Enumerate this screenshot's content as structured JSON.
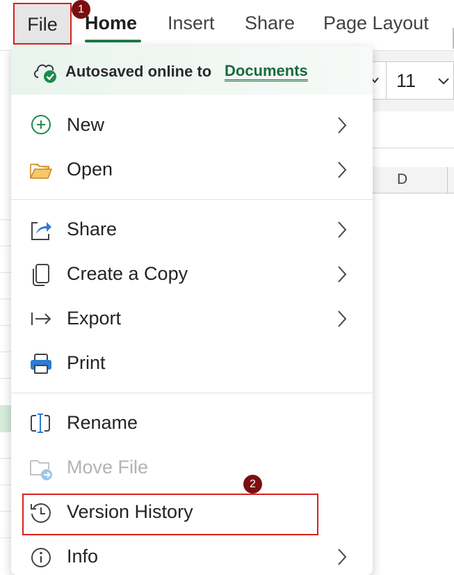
{
  "ribbon": {
    "tabs": [
      {
        "label": "File"
      },
      {
        "label": "Home"
      },
      {
        "label": "Insert"
      },
      {
        "label": "Share"
      },
      {
        "label": "Page Layout"
      }
    ]
  },
  "badges": {
    "first": "1",
    "second": "2"
  },
  "font_size": "11",
  "column_header": "D",
  "autosave": {
    "text": "Autosaved online to",
    "link": "Documents"
  },
  "menu": {
    "items": [
      {
        "label": "New",
        "icon": "plus-circle-icon"
      },
      {
        "label": "Open",
        "icon": "folder-open-icon"
      },
      {
        "label": "Share",
        "icon": "share-icon"
      },
      {
        "label": "Create a Copy",
        "icon": "copy-icon"
      },
      {
        "label": "Export",
        "icon": "export-icon"
      },
      {
        "label": "Print",
        "icon": "printer-icon"
      },
      {
        "label": "Rename",
        "icon": "rename-icon"
      },
      {
        "label": "Move File",
        "icon": "move-file-icon"
      },
      {
        "label": "Version History",
        "icon": "history-icon"
      },
      {
        "label": "Info",
        "icon": "info-icon"
      }
    ]
  },
  "colors": {
    "accent": "#1f7a45",
    "highlight_border": "#d8201e",
    "badge": "#7b0e10"
  }
}
